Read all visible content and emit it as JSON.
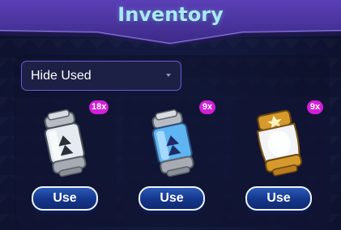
{
  "header": {
    "title": "Inventory"
  },
  "filter": {
    "selected": "Hide Used"
  },
  "items": [
    {
      "name": "silver-canister",
      "count": "18x",
      "button_label": "Use",
      "icon": "silver-canister-icon"
    },
    {
      "name": "blue-canister",
      "count": "9x",
      "button_label": "Use",
      "icon": "blue-canister-icon"
    },
    {
      "name": "gold-canister",
      "count": "9x",
      "button_label": "Use",
      "icon": "gold-canister-icon"
    }
  ],
  "colors": {
    "title": "#a9e9f6",
    "badge": "#d21fd8",
    "button": "#14358a",
    "dropdown_border": "#6a5ad6"
  }
}
